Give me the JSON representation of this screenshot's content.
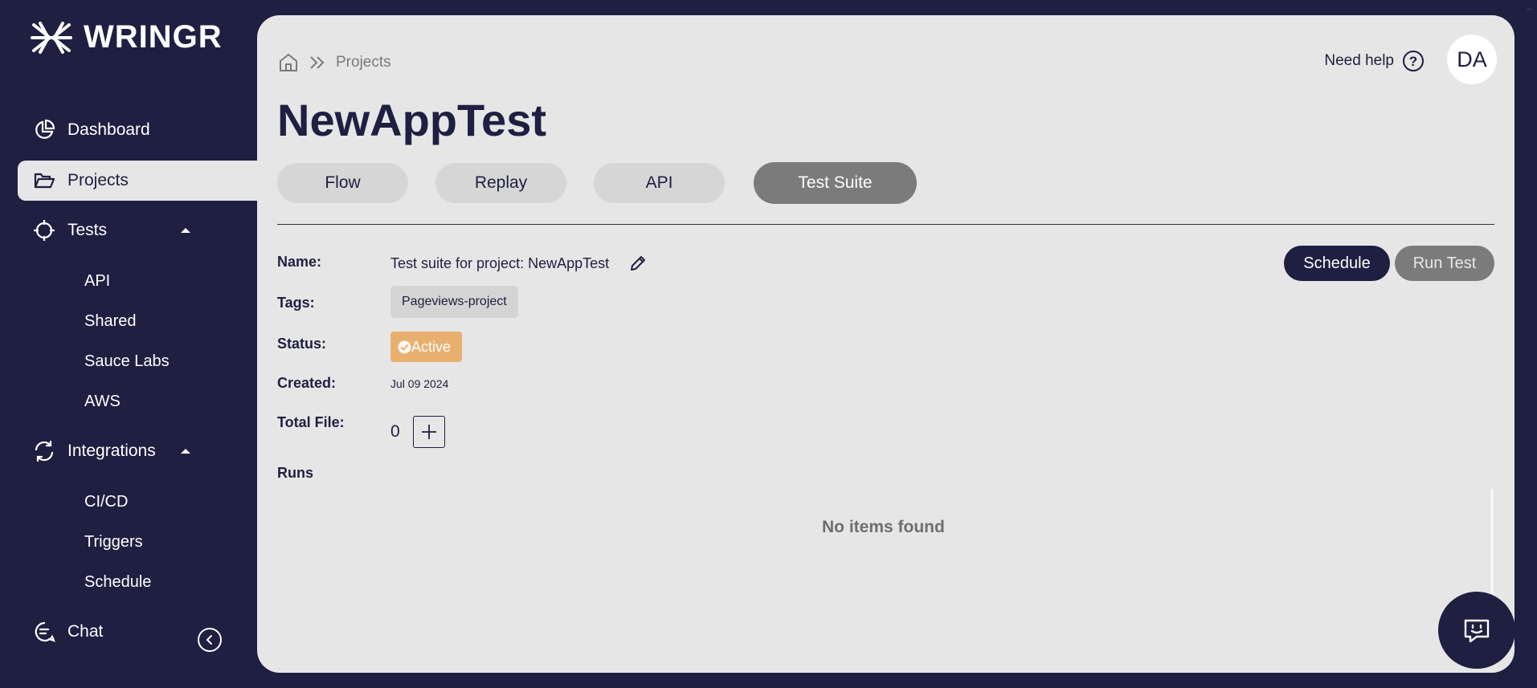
{
  "brand": {
    "name": "WRINGR"
  },
  "sidebar": {
    "items": [
      {
        "label": "Dashboard",
        "icon": "pie-chart-icon"
      },
      {
        "label": "Projects",
        "icon": "folder-icon",
        "active": true
      },
      {
        "label": "Tests",
        "icon": "crosshair-icon",
        "expanded": true,
        "children": [
          "API",
          "Shared",
          "Sauce Labs",
          "AWS"
        ]
      },
      {
        "label": "Integrations",
        "icon": "sync-icon",
        "expanded": true,
        "children": [
          "CI/CD",
          "Triggers",
          "Schedule"
        ]
      },
      {
        "label": "Chat",
        "icon": "chat-bubble-icon"
      }
    ]
  },
  "header": {
    "breadcrumb": [
      "Projects"
    ],
    "help_label": "Need help",
    "avatar_initials": "DA"
  },
  "page": {
    "title": "NewAppTest",
    "tabs": [
      {
        "label": "Flow"
      },
      {
        "label": "Replay"
      },
      {
        "label": "API"
      },
      {
        "label": "Test Suite",
        "active": true
      }
    ]
  },
  "details": {
    "name_label": "Name:",
    "name_value": "Test suite for project: NewAppTest",
    "tags_label": "Tags:",
    "tags": [
      "Pageviews-project"
    ],
    "status_label": "Status:",
    "status_value": "Active",
    "created_label": "Created:",
    "created_value": "Jul 09 2024",
    "total_file_label": "Total File:",
    "total_file_value": "0"
  },
  "actions": {
    "schedule_label": "Schedule",
    "run_test_label": "Run Test"
  },
  "runs": {
    "label": "Runs",
    "empty_text": "No items found"
  },
  "colors": {
    "sidebar_bg": "#1e1f41",
    "panel_bg": "#e6e6e6",
    "status_active": "#e8b06e",
    "tab_active": "#7b7b7b"
  }
}
